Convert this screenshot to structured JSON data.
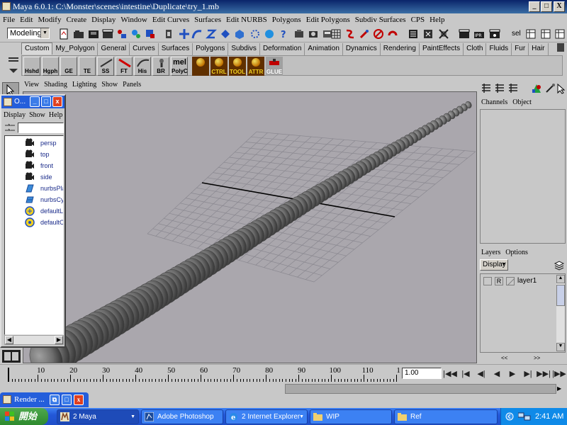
{
  "window": {
    "title": "Maya 6.0.1: C:\\Monster\\scenes\\intestine\\Duplicate\\try_1.mb",
    "minimize_label": "_",
    "maximize_label": "□",
    "close_label": "X"
  },
  "menubar": {
    "items": [
      "File",
      "Edit",
      "Modify",
      "Create",
      "Display",
      "Window",
      "Edit Curves",
      "Surfaces",
      "Edit NURBS",
      "Polygons",
      "Edit Polygons",
      "Subdiv Surfaces",
      "CPS",
      "Help"
    ]
  },
  "statusline": {
    "mode": "Modeling",
    "sel_label": "sel"
  },
  "shelf": {
    "tabs": [
      "Custom",
      "My_Polygon",
      "General",
      "Curves",
      "Surfaces",
      "Polygons",
      "Subdivs",
      "Deformation",
      "Animation",
      "Dynamics",
      "Rendering",
      "PaintEffects",
      "Cloth",
      "Fluids",
      "Fur",
      "Hair"
    ],
    "active_tab": "Custom",
    "buttons": [
      "Hshd",
      "Hgph",
      "GE",
      "TE",
      "SS",
      "FT",
      "His",
      "BR",
      "PolyC",
      "",
      "CTRL",
      "TOOL",
      "ATTR",
      "GLUE"
    ],
    "mel_label": "mel"
  },
  "viewport": {
    "menu": [
      "View",
      "Shading",
      "Lighting",
      "Show",
      "Panels"
    ],
    "colors": {
      "background": "#aaa7ad",
      "grid": "#8a8890",
      "axis": "#000000",
      "tube": "#6e6e6e",
      "selection_border": "#ffffff"
    }
  },
  "outliner": {
    "title": "O...",
    "menu": [
      "Display",
      "Show",
      "Help"
    ],
    "items": [
      {
        "icon": "camera-icon",
        "label": "persp"
      },
      {
        "icon": "camera-icon",
        "label": "top"
      },
      {
        "icon": "camera-icon",
        "label": "front"
      },
      {
        "icon": "camera-icon",
        "label": "side"
      },
      {
        "icon": "nurbs-plane-icon",
        "label": "nurbsPla"
      },
      {
        "icon": "nurbs-cylinder-icon",
        "label": "nurbsCy"
      },
      {
        "icon": "default-light-icon",
        "label": "defaultL"
      },
      {
        "icon": "default-object-set-icon",
        "label": "defaultO"
      }
    ]
  },
  "channelbox": {
    "menu": [
      "Channels",
      "Object"
    ]
  },
  "layers": {
    "menu": [
      "Layers",
      "Options"
    ],
    "mode": "Display",
    "items": [
      {
        "ref": "R",
        "name": "layer1"
      }
    ]
  },
  "timeslider": {
    "labels": [
      "10",
      "20",
      "30",
      "40",
      "50",
      "60",
      "70",
      "80",
      "90",
      "100",
      "110",
      "1"
    ],
    "current_frame": "1.00",
    "playback_buttons": [
      "|◀◀",
      "|◀",
      "◀|",
      "◀",
      "▶",
      "▶|",
      "▶▶|",
      "|▶▶"
    ]
  },
  "render_window": {
    "title": "Render ..."
  },
  "taskbar": {
    "start_label": "開始",
    "tasks": [
      {
        "label": "2 Maya",
        "active": true
      },
      {
        "label": "Adobe Photoshop",
        "active": false
      },
      {
        "label": "2 Internet Explorer",
        "active": false
      },
      {
        "label": "WIP",
        "active": false
      },
      {
        "label": "Ref",
        "active": false
      }
    ],
    "clock": "2:41 AM"
  }
}
